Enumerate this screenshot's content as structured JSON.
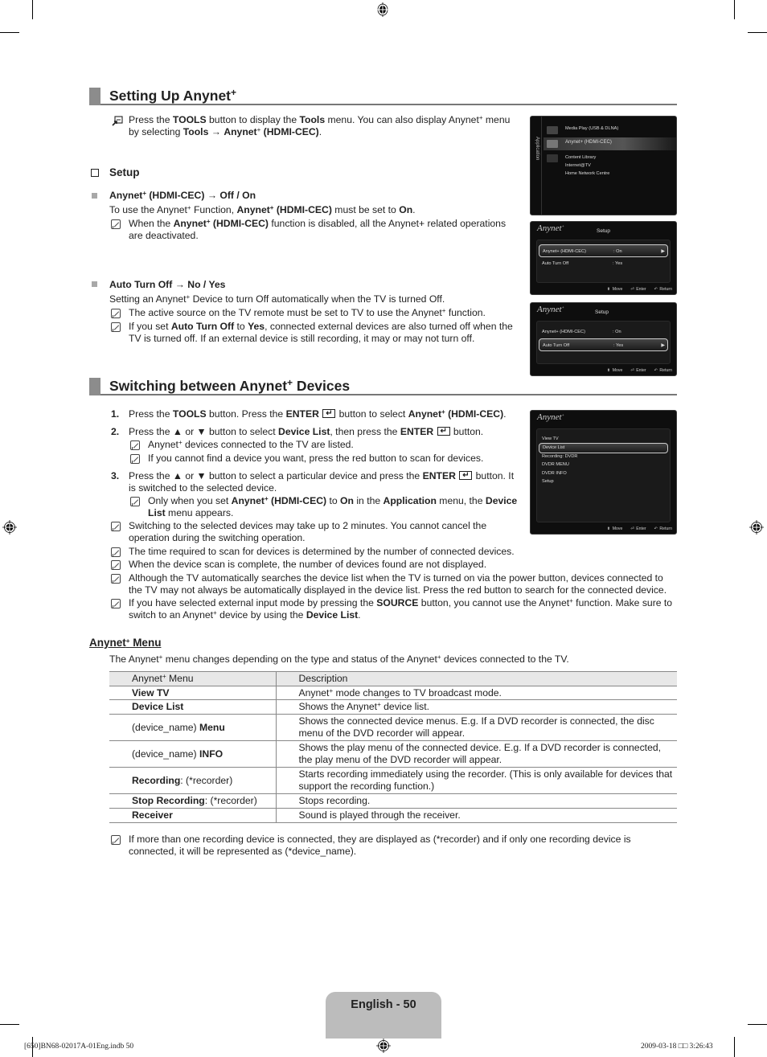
{
  "section1": {
    "title": "Setting Up Anynet",
    "title_sup": "+",
    "tools_note": {
      "t1": "Press the ",
      "b1": "TOOLS",
      "t2": " button to display the ",
      "b2": "Tools",
      "t3": " menu. You can also display Anynet",
      "sup1": "+",
      "t4": " menu",
      "t5": "by selecting ",
      "b3": "Tools",
      "t6": " → ",
      "b4": "Anynet",
      "sup2": "+",
      "b5": " (HDMI-CEC)",
      "t7": "."
    },
    "setup_label": "Setup",
    "item1": {
      "heading_b1": "Anynet",
      "heading_sup": "+",
      "heading_b2": " (HDMI-CEC) ",
      "heading_arrow": "→",
      "heading_b3": " Off / On",
      "line_t1": "To use the Anynet",
      "line_sup": "+",
      "line_t2": " Function, ",
      "line_b1": "Anynet",
      "line_sup2": "+",
      "line_b2": " (HDMI-CEC)",
      "line_t3": " must be set to ",
      "line_b3": "On",
      "line_t4": ".",
      "note_t1": "When the ",
      "note_b1": "Anynet",
      "note_sup": "+",
      "note_b2": " (HDMI-CEC)",
      "note_t2": " function is disabled, all the Anynet+ related operations",
      "note_t3": "are deactivated."
    },
    "item2": {
      "heading_b1": "Auto Turn Off ",
      "heading_arrow": "→",
      "heading_b2": " No / Yes",
      "line_t1": "Setting an Anynet",
      "line_sup": "+",
      "line_t2": " Device to turn Off automatically when the TV is turned Off.",
      "note1_t1": "The active source on the TV remote must be set to TV to use the Anynet",
      "note1_sup": "+",
      "note1_t2": " function.",
      "note2_t1": "If you set ",
      "note2_b1": "Auto Turn Off",
      "note2_t2": " to ",
      "note2_b2": "Yes",
      "note2_t3": ", connected external devices are also turned off when the",
      "note2_t4": "TV is turned off. If an external device is still recording, it may or may not turn off."
    }
  },
  "section2": {
    "title": "Switching between Anynet",
    "title_sup": "+",
    "title_end": " Devices",
    "step1": {
      "num": "1.",
      "t1": "Press the ",
      "b1": "TOOLS",
      "t2": " button. Press the ",
      "b2": "ENTER",
      "t3": " button to select ",
      "b3": "Anynet",
      "sup": "+",
      "b4": " (HDMI-CEC)",
      "t4": "."
    },
    "step2": {
      "num": "2.",
      "t1": "Press the ▲ or ▼ button to select ",
      "b1": "Device List",
      "t2": ", then press the ",
      "b2": "ENTER",
      "t3": " button.",
      "note1_t1": "Anynet",
      "note1_sup": "+",
      "note1_t2": " devices connected to the TV are listed.",
      "note2": "If you cannot find a device you want, press the red button to scan for devices."
    },
    "step3": {
      "num": "3.",
      "t1": "Press the ▲ or ▼ button to select a particular device and press the ",
      "b1": "ENTER",
      "t2": " button. It",
      "t3": "is switched to the selected device.",
      "note_t1": "Only when you set ",
      "note_b1": "Anynet",
      "note_sup": "+",
      "note_b2": " (HDMI-CEC)",
      "note_t2": " to ",
      "note_b3": "On",
      "note_t3": " in the ",
      "note_b4": "Application",
      "note_t4": " menu, the ",
      "note_b5": "Device",
      "note_b6": "List",
      "note_t5": " menu appears."
    },
    "notes": {
      "n1a": "Switching to the selected devices may take up to 2 minutes. You cannot cancel the",
      "n1b": "operation during the switching operation.",
      "n2": "The time required to scan for devices is determined by the number of connected devices.",
      "n3": "When the device scan is complete, the number of devices found are not displayed.",
      "n4a": "Although the TV automatically searches the device list when the TV is turned on via the power button, devices connected to",
      "n4b": "the TV may not always be automatically displayed in the device list. Press the red button to search for the connected device.",
      "n5_t1": "If you have selected external input mode by pressing the ",
      "n5_b1": "SOURCE",
      "n5_t2": " button, you cannot use the Anynet",
      "n5_sup": "+",
      "n5_t3": " function. Make sure to",
      "n5_t4": "switch to an Anynet",
      "n5_sup2": "+",
      "n5_t5": " device by using the ",
      "n5_b2": "Device List",
      "n5_t6": "."
    }
  },
  "anynet_menu": {
    "title": "Anynet",
    "title_sup": "+",
    "title_end": " Menu",
    "intro_t1": "The Anynet",
    "intro_sup": "+",
    "intro_t2": " menu changes depending on the type and status of the Anynet",
    "intro_sup2": "+",
    "intro_t3": " devices connected to the TV.",
    "table": {
      "headers": {
        "menu": "Anynet",
        "menu_sup": "+",
        "menu_end": " Menu",
        "desc": "Description"
      },
      "rows": [
        {
          "pre": "",
          "bold": "View TV",
          "post": "",
          "d1": "Anynet",
          "dsup": "+",
          "d2": " mode changes to TV broadcast mode."
        },
        {
          "pre": "",
          "bold": "Device List",
          "post": "",
          "d1": "Shows the Anynet",
          "dsup": "+",
          "d2": " device list."
        },
        {
          "pre": "(device_name) ",
          "bold": "Menu",
          "post": "",
          "d1": "Shows the connected device menus. E.g. If a DVD recorder is connected, the disc menu of the DVD recorder will appear.",
          "dsup": "",
          "d2": ""
        },
        {
          "pre": "(device_name) ",
          "bold": "INFO",
          "post": "",
          "d1": "Shows the play menu of the connected device. E.g. If a DVD recorder is connected, the play menu of the DVD recorder will appear.",
          "dsup": "",
          "d2": ""
        },
        {
          "pre": "",
          "bold": "Recording",
          "post": ": (*recorder)",
          "d1": "Starts recording immediately using the recorder. (This is only available for devices that support the recording function.)",
          "dsup": "",
          "d2": ""
        },
        {
          "pre": "",
          "bold": "Stop Recording",
          "post": ": (*recorder)",
          "d1": "Stops recording.",
          "dsup": "",
          "d2": ""
        },
        {
          "pre": "",
          "bold": "Receiver",
          "post": "",
          "d1": "Sound is played through the receiver.",
          "dsup": "",
          "d2": ""
        }
      ]
    },
    "final_note_a": "If more than one recording device is connected, they are displayed as (*recorder) and if only one recording device is",
    "final_note_b": "connected, it will be represented as (*device_name)."
  },
  "tv_screens": {
    "application": {
      "side_label": "Application",
      "items": [
        "Media Play (USB & DLNA)",
        "Anynet+ (HDMI-CEC)",
        "Content Library",
        "Internet@TV",
        "Home Network Centre"
      ],
      "selected": "Anynet+ (HDMI-CEC)"
    },
    "setup1": {
      "logo": "Anynet",
      "logo_sup": "+",
      "heading": "Setup",
      "rows": [
        {
          "label": "Anynet+ (HDMI-CEC)",
          "value": ": On"
        },
        {
          "label": "Auto Turn Off",
          "value": ": Yes"
        }
      ],
      "selected_index": 0
    },
    "setup2": {
      "logo": "Anynet",
      "logo_sup": "+",
      "heading": "Setup",
      "rows": [
        {
          "label": "Anynet+ (HDMI-CEC)",
          "value": ": On"
        },
        {
          "label": "Auto Turn Off",
          "value": ": Yes"
        }
      ],
      "selected_index": 1
    },
    "device_menu": {
      "logo": "Anynet",
      "logo_sup": "+",
      "items": [
        "View TV",
        "Device List",
        "Recording: DVDR",
        "DVDR MENU",
        "DVDR INFO",
        "Setup"
      ],
      "selected": "Device List"
    },
    "footer": {
      "move": "Move",
      "enter": "Enter",
      "return": "Return"
    }
  },
  "page": {
    "label": "English - 50",
    "print_left": "[650]BN68-02017A-01Eng.indb   50",
    "print_right": "2009-03-18   □□ 3:26:43"
  }
}
